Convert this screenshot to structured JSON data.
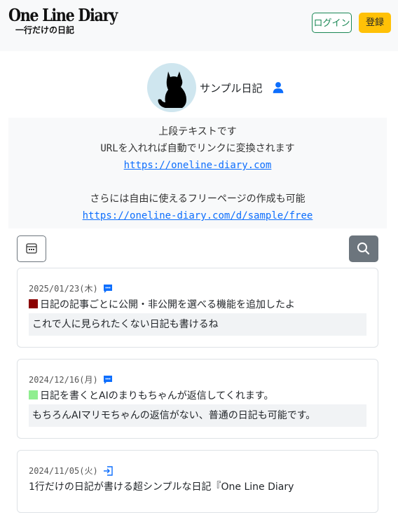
{
  "header": {
    "logo_title": "One Line Diary",
    "logo_subtitle": "一行だけの日記",
    "login_label": "ログイン",
    "register_label": "登録"
  },
  "profile": {
    "name": "サンプル日記",
    "avatar": "black-cat-silhouette",
    "owner_icon": "person-icon"
  },
  "intro": {
    "line1": "上段テキストです",
    "line2": "URLを入れれば自動でリンクに変換されます",
    "link1": "https://oneline-diary.com",
    "line3": "さらには自由に使えるフリーページの作成も可能",
    "link2": "https://oneline-diary.com/d/sample/free"
  },
  "toolbar": {
    "calendar_icon": "calendar-icon",
    "search_icon": "search-icon"
  },
  "entries": [
    {
      "date": "2025/01/23(木)",
      "icon": "comment-icon",
      "marker_color": "#8b0000",
      "text": "日記の記事ごとに公開・非公開を選べる機能を追加したよ",
      "reply": "これで人に見られたくない日記も書けるね"
    },
    {
      "date": "2024/12/16(月)",
      "icon": "comment-icon",
      "marker_color": "#90ee90",
      "text": "日記を書くとAIのまりもちゃんが返信してくれます。",
      "reply": "もちろんAIマリモちゃんの返信がない、普通の日記も可能です。"
    },
    {
      "date": "2024/11/05(火)",
      "icon": "sign-in-icon",
      "text": "1行だけの日記が書ける超シンプルな日記『One Line Diary"
    }
  ],
  "colors": {
    "accent_blue": "#0d6efd",
    "login_green": "#198754",
    "register_yellow": "#ffc107",
    "search_gray": "#6c757d"
  }
}
